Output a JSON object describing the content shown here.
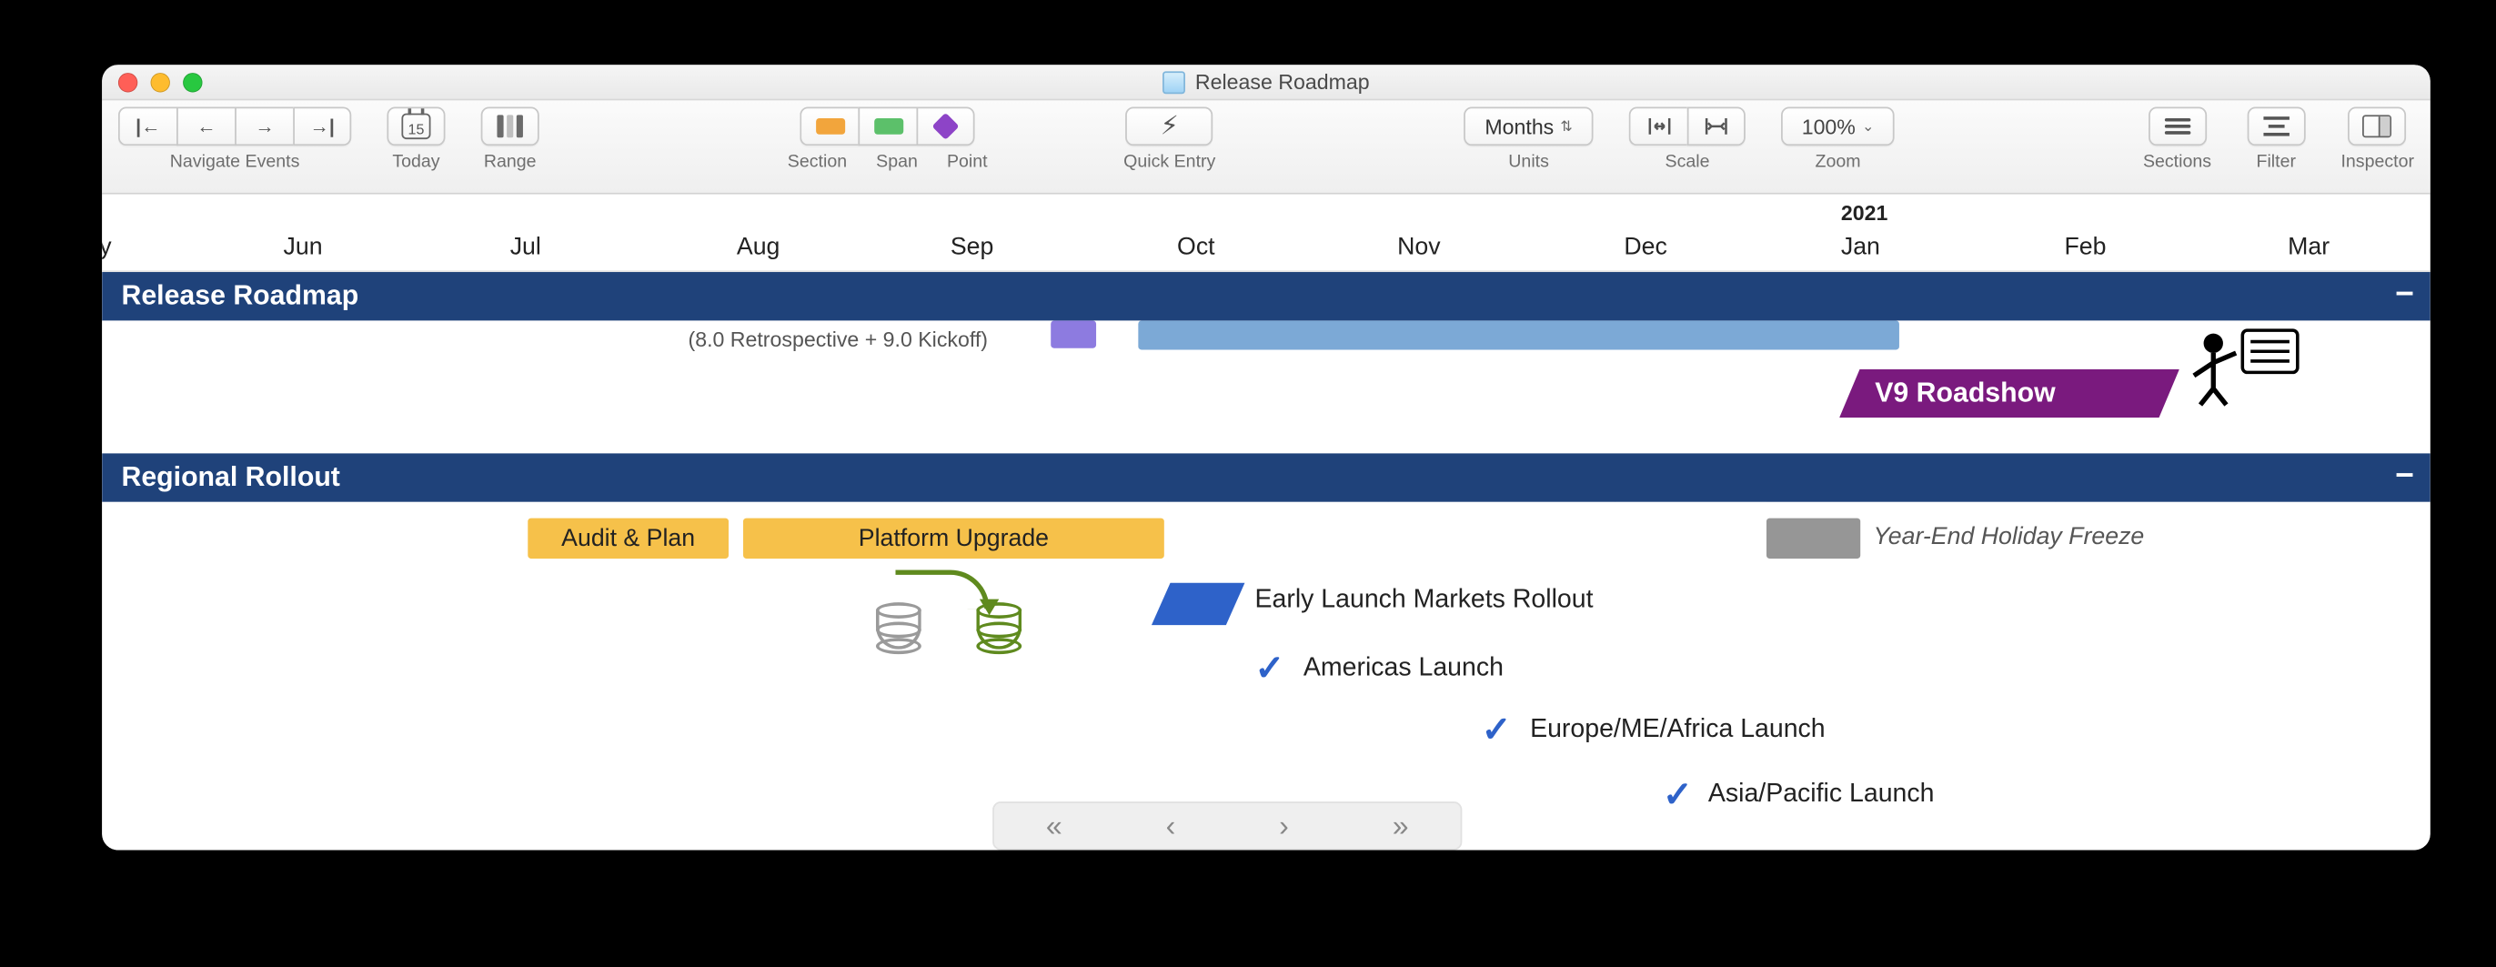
{
  "window": {
    "title": "Release Roadmap"
  },
  "toolbar": {
    "navigate_label": "Navigate Events",
    "today_label": "Today",
    "today_day": "15",
    "range_label": "Range",
    "section_label": "Section",
    "span_label": "Span",
    "point_label": "Point",
    "quick_entry_label": "Quick Entry",
    "units_value": "Months",
    "units_label": "Units",
    "scale_label": "Scale",
    "zoom_value": "100%",
    "zoom_label": "Zoom",
    "sections_label": "Sections",
    "filter_label": "Filter",
    "inspector_label": "Inspector"
  },
  "timeline": {
    "year": "2021",
    "months": [
      "ay",
      "Jun",
      "Jul",
      "Aug",
      "Sep",
      "Oct",
      "Nov",
      "Dec",
      "Jan",
      "Feb",
      "Mar"
    ],
    "month_x": [
      -10,
      112,
      252,
      392,
      524,
      664,
      800,
      940,
      1074,
      1212,
      1350
    ]
  },
  "sections": {
    "release": {
      "title": "Release Roadmap",
      "workshop_sub": "(8.0 Retrospective + 9.0 Kickoff)",
      "roadshow": "V9 Roadshow"
    },
    "regional": {
      "title": "Regional Rollout",
      "audit": "Audit & Plan",
      "upgrade": "Platform Upgrade",
      "freeze": "Year-End Holiday Freeze",
      "early": "Early Launch Markets Rollout",
      "americas": "Americas Launch",
      "emea": "Europe/ME/Africa Launch",
      "apac": "Asia/Pacific Launch"
    }
  }
}
